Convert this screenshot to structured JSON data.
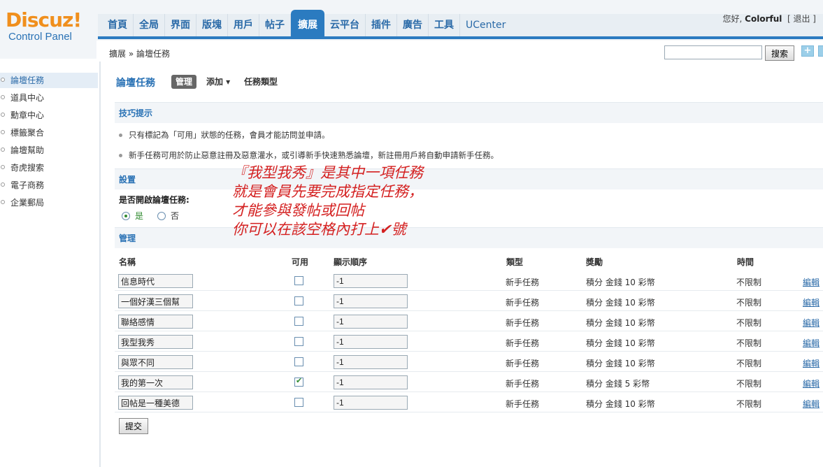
{
  "logo": {
    "main": "Discuz!",
    "sub": "Control Panel"
  },
  "nav": [
    "首頁",
    "全局",
    "界面",
    "版塊",
    "用戶",
    "帖子",
    "擴展",
    "云平台",
    "插件",
    "廣告",
    "工具",
    "UCenter"
  ],
  "nav_active_index": 6,
  "user": {
    "greeting": "您好,",
    "name": "Colorful",
    "logout": "[ 退出 ]"
  },
  "breadcrumb": "擴展 » 論壇任務",
  "search": {
    "button": "搜索",
    "value": ""
  },
  "plus_icon": "+",
  "sidebar": {
    "items": [
      "論壇任務",
      "道具中心",
      "勳章中心",
      "標籤聚合",
      "論壇幫助",
      "奇虎搜索",
      "電子商務",
      "企業郵局"
    ],
    "active_index": 0
  },
  "page": {
    "title": "論壇任務",
    "tabs": {
      "manage": "管理",
      "add": "添加 ▾",
      "type": "任務類型"
    }
  },
  "tips": {
    "title": "技巧提示",
    "items": [
      "只有標記為「可用」狀態的任務，會員才能訪問並申請。",
      "新手任務可用於防止惡意註冊及惡意灌水，或引導新手快速熟悉論壇，新註冊用戶將自動申請新手任務。"
    ]
  },
  "settings": {
    "title": "設置",
    "label": "是否開啟論壇任務:",
    "yes": "是",
    "no": "否",
    "selected": "yes"
  },
  "annotation": [
    "『我型我秀』是其中一項任務",
    "就是會員先要完成指定任務，",
    "才能參與發帖或回帖",
    "你可以在該空格內打上✔號"
  ],
  "manage": {
    "title": "管理",
    "headers": {
      "name": "名稱",
      "enabled": "可用",
      "order": "顯示順序",
      "type": "類型",
      "reward": "獎勵",
      "time": "時間"
    },
    "rows": [
      {
        "name": "信息時代",
        "enabled": false,
        "order": "-1",
        "type": "新手任務",
        "reward": "積分 金錢 10 彩幣",
        "time": "不限制",
        "edit": "編輯"
      },
      {
        "name": "一個好漢三個幫",
        "enabled": false,
        "order": "-1",
        "type": "新手任務",
        "reward": "積分 金錢 10 彩幣",
        "time": "不限制",
        "edit": "編輯"
      },
      {
        "name": "聯絡感情",
        "enabled": false,
        "order": "-1",
        "type": "新手任務",
        "reward": "積分 金錢 10 彩幣",
        "time": "不限制",
        "edit": "編輯"
      },
      {
        "name": "我型我秀",
        "enabled": false,
        "order": "-1",
        "type": "新手任務",
        "reward": "積分 金錢 10 彩幣",
        "time": "不限制",
        "edit": "編輯"
      },
      {
        "name": "與眾不同",
        "enabled": false,
        "order": "-1",
        "type": "新手任務",
        "reward": "積分 金錢 10 彩幣",
        "time": "不限制",
        "edit": "編輯"
      },
      {
        "name": "我的第一次",
        "enabled": true,
        "order": "-1",
        "type": "新手任務",
        "reward": "積分 金錢 5 彩幣",
        "time": "不限制",
        "edit": "編輯"
      },
      {
        "name": "回帖是一種美德",
        "enabled": false,
        "order": "-1",
        "type": "新手任務",
        "reward": "積分 金錢 10 彩幣",
        "time": "不限制",
        "edit": "編輯"
      }
    ],
    "submit": "提交"
  }
}
